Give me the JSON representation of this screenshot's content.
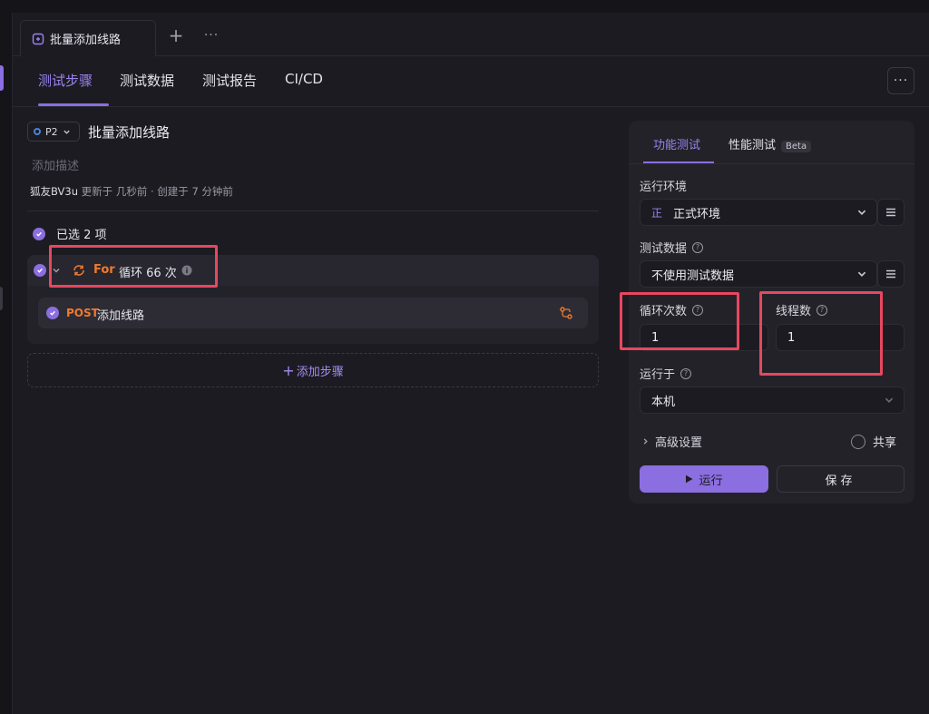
{
  "document_tab": {
    "title": "批量添加线路"
  },
  "subtabs": [
    {
      "label": "测试步骤"
    },
    {
      "label": "测试数据"
    },
    {
      "label": "测试报告"
    },
    {
      "label": "CI/CD"
    }
  ],
  "case": {
    "priority": "P2",
    "title": "批量添加线路",
    "description_placeholder": "添加描述",
    "author": "狐友BV3u",
    "meta_rest": " 更新于 几秒前 · 创建于 7 分钟前"
  },
  "steps": {
    "selected_label": "已选 2 项",
    "for_keyword": "For",
    "for_text": "循环 66 次",
    "post_method": "POST",
    "post_name": "添加线路",
    "add_step_label": "添加步骤"
  },
  "panel": {
    "tab_functional": "功能测试",
    "tab_performance": "性能测试",
    "beta_label": "Beta",
    "run_env_label": "运行环境",
    "env_tag": "正",
    "env_value": "正式环境",
    "test_data_label": "测试数据",
    "test_data_value": "不使用测试数据",
    "loop_count_label": "循环次数",
    "loop_count_value": "1",
    "thread_count_label": "线程数",
    "thread_count_value": "1",
    "run_on_label": "运行于",
    "run_on_value": "本机",
    "advanced_label": "高级设置",
    "share_label": "共享",
    "run_button": "运行",
    "save_button": "保存"
  },
  "colors": {
    "accent": "#8b6ee0",
    "method_orange": "#ef7a2e",
    "highlight_red": "#e8475f"
  }
}
